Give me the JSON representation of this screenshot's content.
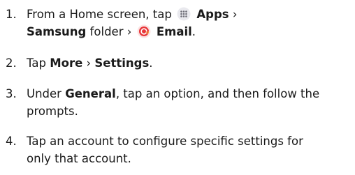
{
  "steps": [
    {
      "number": "1.",
      "line1_pre": "From a Home screen, tap",
      "line1_apps": "Apps",
      "line1_sep": "›",
      "line2_samsung": "Samsung",
      "line2_folder": "folder",
      "line2_sep": "›",
      "line2_email": "Email",
      "line2_end": ".",
      "icons": [
        "apps-grid-icon",
        "email-app-icon"
      ]
    },
    {
      "number": "2.",
      "pre": "Tap",
      "more": "More",
      "sep": "›",
      "settings": "Settings",
      "end": "."
    },
    {
      "number": "3.",
      "pre": "Under",
      "general": "General",
      "line1_rest": ", tap an option, and then follow the",
      "line2": "prompts."
    },
    {
      "number": "4.",
      "line1": "Tap an account to configure specific settings for",
      "line2": "only that account."
    }
  ],
  "colors": {
    "text": "#1a1a1a",
    "apps_icon_bg": "#e9e9ee",
    "email_icon_red": "#e8363a",
    "email_icon_orange": "#f5a044"
  }
}
